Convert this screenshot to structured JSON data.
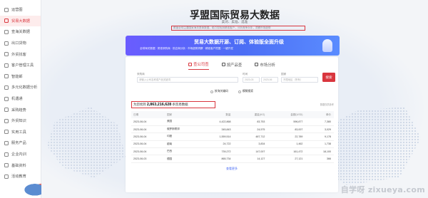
{
  "sidebar": {
    "items": [
      {
        "label": "运营图",
        "active": false
      },
      {
        "label": "贸易大数据",
        "active": true
      },
      {
        "label": "查海关数据",
        "active": false
      },
      {
        "label": "出口货物",
        "active": false
      },
      {
        "label": "外贸找客",
        "active": false
      },
      {
        "label": "客户管理工具",
        "active": false
      },
      {
        "label": "智能邮",
        "active": false
      },
      {
        "label": "多元化数据分析",
        "active": false
      },
      {
        "label": "机遇通",
        "active": false
      },
      {
        "label": "采购趋势",
        "active": false
      },
      {
        "label": "外贸知识",
        "active": false
      },
      {
        "label": "实用工具",
        "active": false
      },
      {
        "label": "服务产品",
        "active": false
      },
      {
        "label": "企业内训",
        "active": false
      },
      {
        "label": "基础资料",
        "active": false
      },
      {
        "label": "活动教育",
        "active": false
      }
    ]
  },
  "header": {
    "title": "孚盟国际贸易大数据",
    "subtitle": "卖对、卖准、选准",
    "description": "覆盖全球主要国家海关提单数据，助力您找到精准客户，分析竞争对手，洞察市场趋势"
  },
  "banner": {
    "title": "贸易大数据开源、订阅、体验版全面升级",
    "subtitle": "全球海关数据  ·  贸易采购商  ·  供应商分析  ·  市场趋势洞察  ·  精准客户挖掘  ·  一键开发"
  },
  "tabs": [
    {
      "label": "查公司查",
      "active": true
    },
    {
      "label": "按产品查",
      "active": false
    },
    {
      "label": "市场分析",
      "active": false
    }
  ],
  "search": {
    "company_label": "采购商",
    "company_placeholder": "请输入公司名称或产品关键词",
    "date_label": "时间",
    "date_from": "2023-03",
    "date_to": "2023-06",
    "country_label": "国家",
    "country_value": "不限地区（所有）",
    "button": "搜索"
  },
  "options": [
    "按海关编码",
    "模糊搜索"
  ],
  "result": {
    "prefix": "为您找到",
    "count": "2,863,216,628",
    "suffix": "条贸易数据",
    "note": "数据仅供参考"
  },
  "table": {
    "headers": [
      "日期",
      "国家",
      "数量",
      "重量(KG)",
      "金额(USD)",
      "单价"
    ],
    "rows": [
      [
        "2023-06-04",
        "美国",
        "4,422,868",
        "83,753",
        "596,877",
        "7,380"
      ],
      [
        "2023-06-04",
        "俄罗斯联邦",
        "345,843",
        "24,575",
        "83,007",
        "3,029"
      ],
      [
        "2023-06-04",
        "印度",
        "1,559,514",
        "487,712",
        "22,789",
        "9,178"
      ],
      [
        "2023-06-04",
        "越南",
        "24,722",
        "3,834",
        "1,462",
        "1,738"
      ],
      [
        "2023-06-04",
        "巴西",
        "739,272",
        "147,007",
        "161,472",
        "18,100"
      ],
      [
        "2023-06-03",
        "德国",
        "865,734",
        "14,127",
        "27,121",
        "366"
      ]
    ]
  },
  "more_label": "查看更多",
  "watermark": "自学呀 zixueya.com"
}
